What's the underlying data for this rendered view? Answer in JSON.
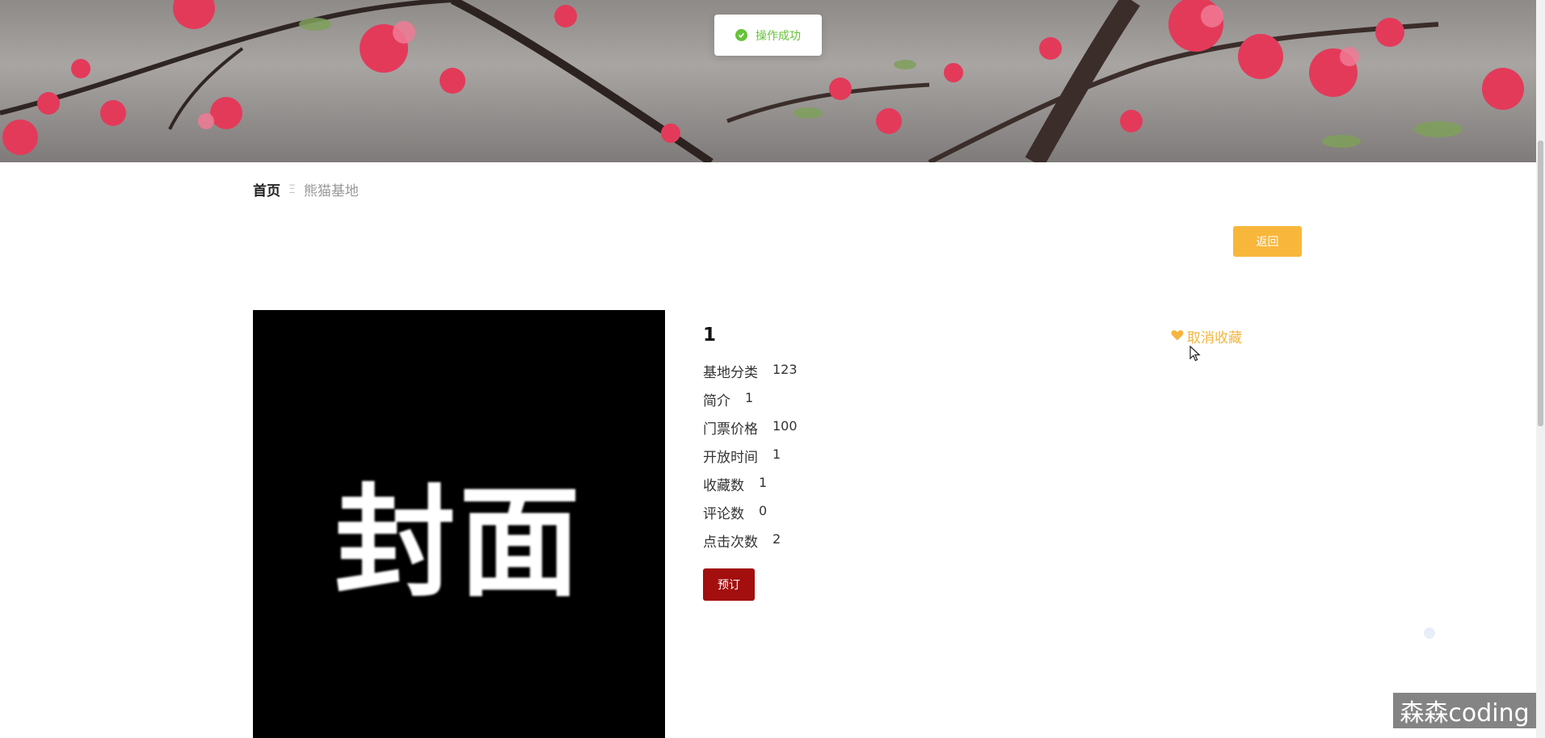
{
  "toast": {
    "message": "操作成功"
  },
  "breadcrumb": {
    "home": "首页",
    "separator": "Ξ",
    "current": "熊猫基地"
  },
  "actions": {
    "back_label": "返回",
    "book_label": "预订",
    "unfavorite_label": "取消收藏"
  },
  "cover": {
    "text": "封面"
  },
  "detail": {
    "title": "1",
    "fields": [
      {
        "label": "基地分类",
        "value": "123"
      },
      {
        "label": "简介",
        "value": "1"
      },
      {
        "label": "门票价格",
        "value": "100"
      },
      {
        "label": "开放时间",
        "value": "1"
      },
      {
        "label": "收藏数",
        "value": "1"
      },
      {
        "label": "评论数",
        "value": "0"
      },
      {
        "label": "点击次数",
        "value": "2"
      }
    ]
  },
  "watermark": {
    "text": "森森coding"
  },
  "colors": {
    "accent": "#f8b73b",
    "book_button": "#a30e0e",
    "success": "#67c23a",
    "favorite": "#f5b53f"
  },
  "icons": {
    "toast": "check-circle-icon",
    "favorite": "heart-icon",
    "cursor": "mouse-pointer-icon"
  }
}
